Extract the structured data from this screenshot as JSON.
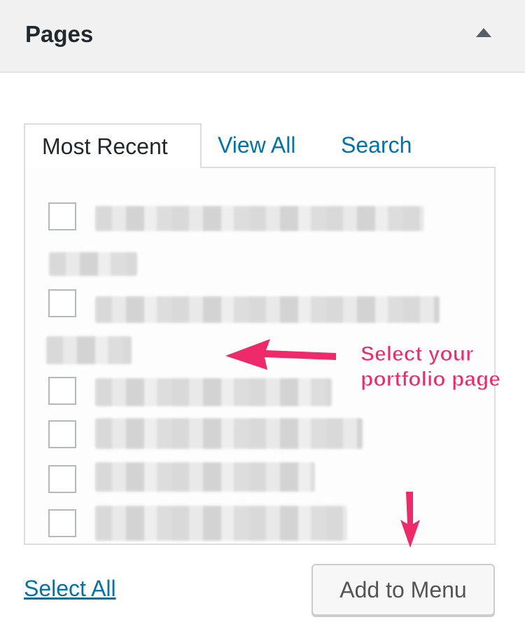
{
  "panel": {
    "title": "Pages"
  },
  "tabs": [
    {
      "label": "Most Recent",
      "active": true
    },
    {
      "label": "View All",
      "active": false
    },
    {
      "label": "Search",
      "active": false
    }
  ],
  "page_list": {
    "items": [
      {
        "checked": false,
        "label_redacted": true
      },
      {
        "checked": false,
        "label_redacted": true
      },
      {
        "checked": false,
        "label_redacted": true
      },
      {
        "checked": false,
        "label_redacted": true
      },
      {
        "checked": false,
        "label_redacted": true
      },
      {
        "checked": false,
        "label_redacted": true
      }
    ]
  },
  "annotation": {
    "line1": "Select your",
    "line2": "portfolio page",
    "color": "#ee2a6a"
  },
  "footer": {
    "select_all_label": "Select All",
    "add_button_label": "Add to Menu"
  },
  "colors": {
    "link": "#0073aa",
    "text": "#23282d",
    "header_bg": "#f1f1f1"
  }
}
